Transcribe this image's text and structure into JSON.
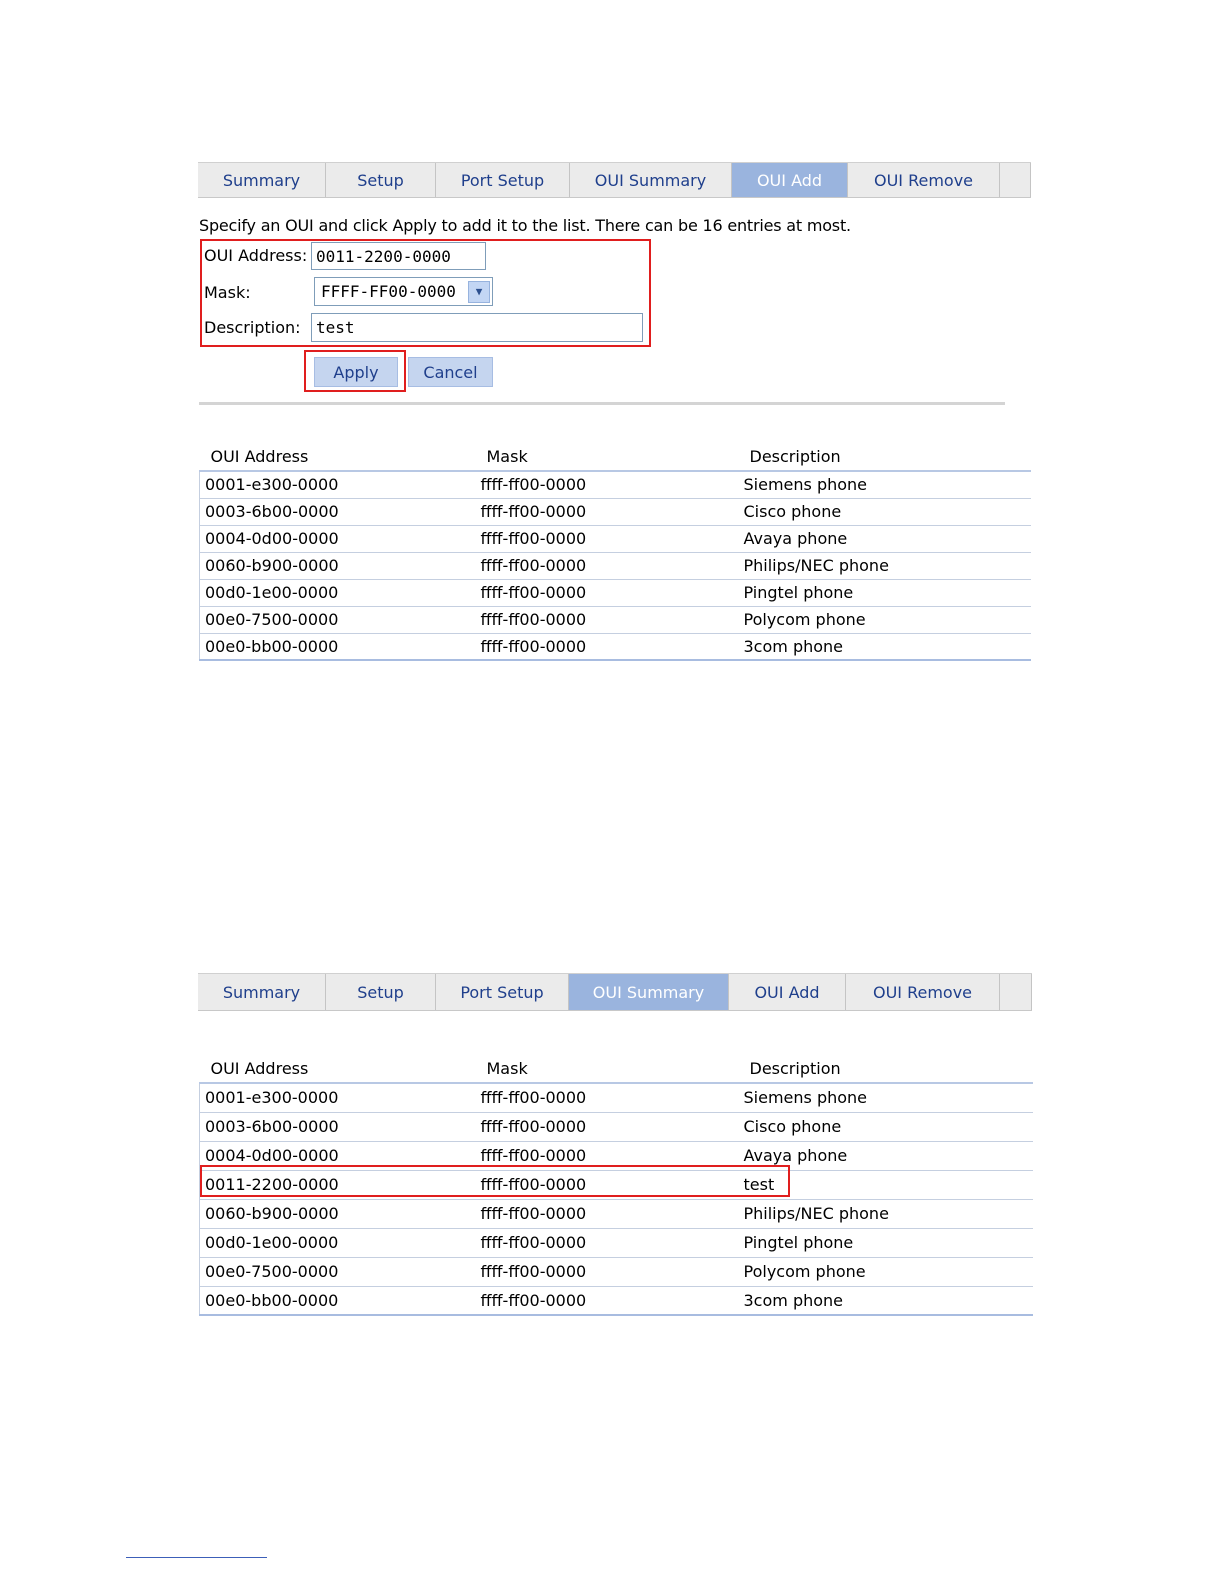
{
  "screen1": {
    "tabs": [
      {
        "label": "Summary",
        "active": false
      },
      {
        "label": "Setup",
        "active": false
      },
      {
        "label": "Port Setup",
        "active": false
      },
      {
        "label": "OUI Summary",
        "active": false
      },
      {
        "label": "OUI Add",
        "active": true
      },
      {
        "label": "OUI Remove",
        "active": false
      }
    ],
    "instruction": "Specify an OUI and click Apply to add it to the list. There can be 16 entries at most.",
    "form": {
      "oui_label": "OUI Address:",
      "oui_value": "0011-2200-0000",
      "mask_label": "Mask:",
      "mask_value": "FFFF-FF00-0000",
      "description_label": "Description:",
      "description_value": "test"
    },
    "buttons": {
      "apply": "Apply",
      "cancel": "Cancel"
    },
    "table": {
      "headers": [
        "OUI Address",
        "Mask",
        "Description"
      ],
      "rows": [
        [
          "0001-e300-0000",
          "ffff-ff00-0000",
          "Siemens phone"
        ],
        [
          "0003-6b00-0000",
          "ffff-ff00-0000",
          "Cisco phone"
        ],
        [
          "0004-0d00-0000",
          "ffff-ff00-0000",
          "Avaya phone"
        ],
        [
          "0060-b900-0000",
          "ffff-ff00-0000",
          "Philips/NEC phone"
        ],
        [
          "00d0-1e00-0000",
          "ffff-ff00-0000",
          "Pingtel phone"
        ],
        [
          "00e0-7500-0000",
          "ffff-ff00-0000",
          "Polycom phone"
        ],
        [
          "00e0-bb00-0000",
          "ffff-ff00-0000",
          "3com phone"
        ]
      ]
    }
  },
  "screen2": {
    "tabs": [
      {
        "label": "Summary",
        "active": false
      },
      {
        "label": "Setup",
        "active": false
      },
      {
        "label": "Port Setup",
        "active": false
      },
      {
        "label": "OUI Summary",
        "active": true
      },
      {
        "label": "OUI Add",
        "active": false
      },
      {
        "label": "OUI Remove",
        "active": false
      }
    ],
    "table": {
      "headers": [
        "OUI Address",
        "Mask",
        "Description"
      ],
      "rows": [
        [
          "0001-e300-0000",
          "ffff-ff00-0000",
          "Siemens phone"
        ],
        [
          "0003-6b00-0000",
          "ffff-ff00-0000",
          "Cisco phone"
        ],
        [
          "0004-0d00-0000",
          "ffff-ff00-0000",
          "Avaya phone"
        ],
        [
          "0011-2200-0000",
          "ffff-ff00-0000",
          "test"
        ],
        [
          "0060-b900-0000",
          "ffff-ff00-0000",
          "Philips/NEC phone"
        ],
        [
          "00d0-1e00-0000",
          "ffff-ff00-0000",
          "Pingtel phone"
        ],
        [
          "00e0-7500-0000",
          "ffff-ff00-0000",
          "Polycom phone"
        ],
        [
          "00e0-bb00-0000",
          "ffff-ff00-0000",
          "3com phone"
        ]
      ],
      "highlighted_row": 3
    }
  },
  "colors": {
    "highlight": "#e01e1e",
    "active_tab": "#9ab4de",
    "tab_text": "#1f3f8c",
    "button": "#c5d5ef"
  }
}
